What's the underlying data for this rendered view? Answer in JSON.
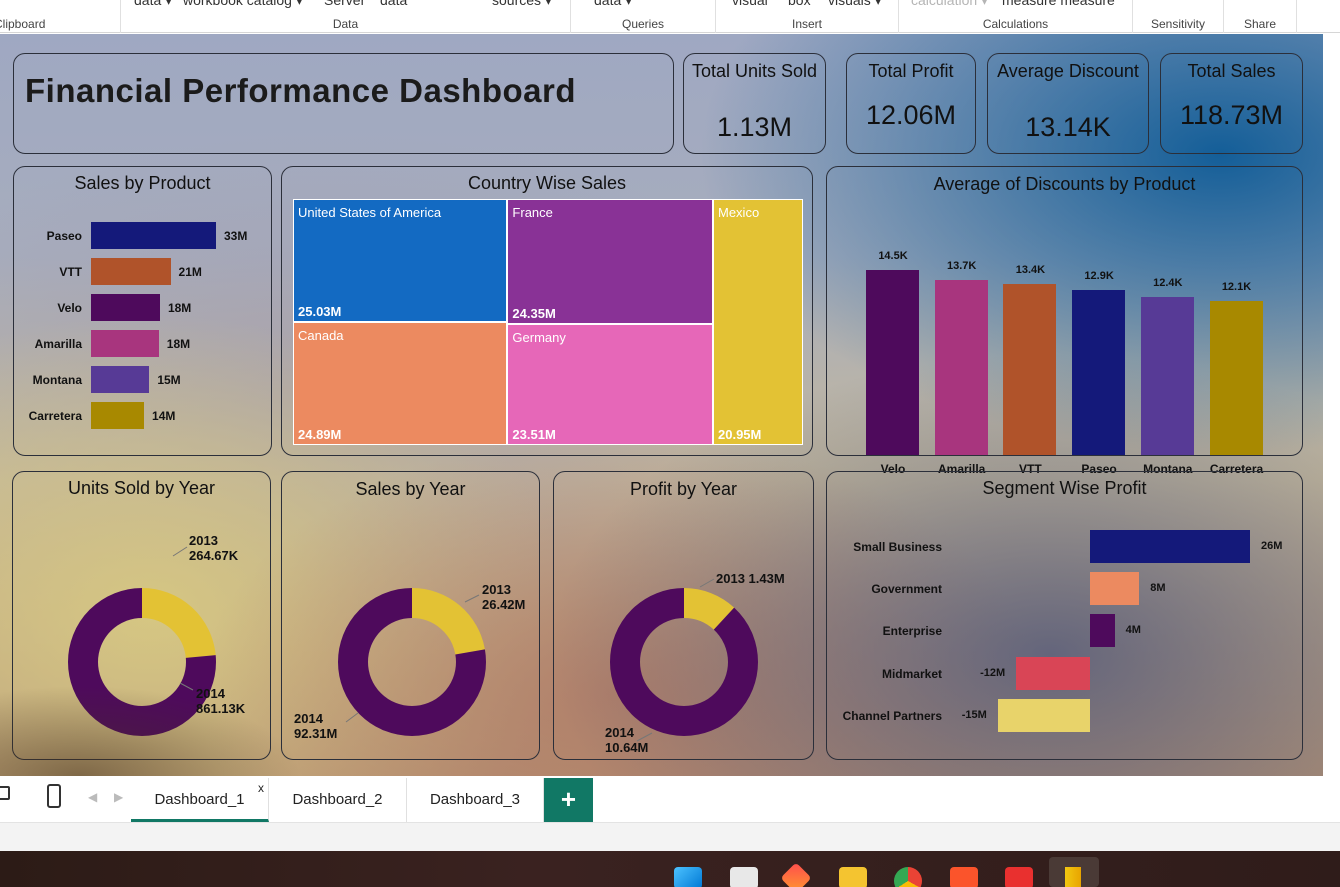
{
  "ribbon": {
    "groups": [
      {
        "label": "Clipboard"
      },
      {
        "label": "Data",
        "items": [
          "data ▾",
          "workbook catalog ▾",
          "Server",
          "data",
          "sources ▾"
        ]
      },
      {
        "label": "Queries",
        "items": [
          "data ▾"
        ]
      },
      {
        "label": "Insert",
        "items": [
          "visual",
          "box",
          "visuals ▾"
        ]
      },
      {
        "label": "Calculations",
        "items": [
          "calculation ▾",
          "measure measure"
        ]
      },
      {
        "label": "Sensitivity"
      },
      {
        "label": "Share"
      }
    ]
  },
  "dashboard": {
    "title": "Financial Performance Dashboard",
    "kpis": [
      {
        "title": "Total Units Sold",
        "value": "1.13M"
      },
      {
        "title": "Total Profit",
        "value": "12.06M"
      },
      {
        "title": "Average Discount",
        "value": "13.14K"
      },
      {
        "title": "Total Sales",
        "value": "118.73M"
      }
    ],
    "sales_by_product": {
      "title": "Sales by Product",
      "items": [
        {
          "label": "Paseo",
          "value": "33M",
          "num": 33,
          "color": "#14197a"
        },
        {
          "label": "VTT",
          "value": "21M",
          "num": 21,
          "color": "#b0532a"
        },
        {
          "label": "Velo",
          "value": "18M",
          "num": 18.2,
          "color": "#4e0a5c"
        },
        {
          "label": "Amarilla",
          "value": "18M",
          "num": 17.9,
          "color": "#a8357e"
        },
        {
          "label": "Montana",
          "value": "15M",
          "num": 15.4,
          "color": "#573a96"
        },
        {
          "label": "Carretera",
          "value": "14M",
          "num": 14,
          "color": "#a88900"
        }
      ]
    },
    "country_sales": {
      "title": "Country Wise Sales",
      "cells": [
        {
          "name": "United States of America",
          "value": "25.03M",
          "color": "#136ac2"
        },
        {
          "name": "France",
          "value": "24.35M",
          "color": "#893296"
        },
        {
          "name": "Mexico",
          "value": "20.95M",
          "color": "#e3c234"
        },
        {
          "name": "Canada",
          "value": "24.89M",
          "color": "#ec8a60"
        },
        {
          "name": "Germany",
          "value": "23.51M",
          "color": "#e667b8"
        }
      ]
    },
    "avg_discount": {
      "title": "Average of Discounts by Product",
      "items": [
        {
          "label": "Velo",
          "value": "14.5K",
          "num": 14.5,
          "color": "#4e0a5c"
        },
        {
          "label": "Amarilla",
          "value": "13.7K",
          "num": 13.7,
          "color": "#a8357e"
        },
        {
          "label": "VTT",
          "value": "13.4K",
          "num": 13.4,
          "color": "#b0532a"
        },
        {
          "label": "Paseo",
          "value": "12.9K",
          "num": 12.9,
          "color": "#14197a"
        },
        {
          "label": "Montana",
          "value": "12.4K",
          "num": 12.4,
          "color": "#573a96"
        },
        {
          "label": "Carretera",
          "value": "12.1K",
          "num": 12.1,
          "color": "#a88900"
        }
      ]
    },
    "units_by_year": {
      "title": "Units Sold by Year",
      "slices": [
        {
          "year": "2013",
          "value": "264.67K",
          "num": 264.67,
          "color": "#e3c234"
        },
        {
          "year": "2014",
          "value": "861.13K",
          "num": 861.13,
          "color": "#4e0a5c"
        }
      ]
    },
    "sales_by_year": {
      "title": "Sales by Year",
      "slices": [
        {
          "year": "2013",
          "value": "26.42M",
          "num": 26.42,
          "color": "#e3c234"
        },
        {
          "year": "2014",
          "value": "92.31M",
          "num": 92.31,
          "color": "#4e0a5c"
        }
      ]
    },
    "profit_by_year": {
      "title": "Profit by Year",
      "slices": [
        {
          "year": "2013",
          "value": "1.43M",
          "num": 1.43,
          "color": "#e3c234"
        },
        {
          "year": "2014",
          "value": "10.64M",
          "num": 10.64,
          "color": "#4e0a5c"
        }
      ]
    },
    "segment_profit": {
      "title": "Segment Wise Profit",
      "items": [
        {
          "label": "Small Business",
          "value": "26M",
          "num": 26,
          "color": "#14197a"
        },
        {
          "label": "Government",
          "value": "8M",
          "num": 8,
          "color": "#ec8a60"
        },
        {
          "label": "Enterprise",
          "value": "4M",
          "num": 4,
          "color": "#4e0a5c"
        },
        {
          "label": "Midmarket",
          "value": "-12M",
          "num": -12,
          "color": "#d94556"
        },
        {
          "label": "Channel Partners",
          "value": "-15M",
          "num": -15,
          "color": "#e8d36a"
        }
      ]
    }
  },
  "tabs": {
    "pages": [
      {
        "label": "Dashboard_1",
        "active": true
      },
      {
        "label": "Dashboard_2"
      },
      {
        "label": "Dashboard_3"
      }
    ],
    "close_glyph": "x",
    "add_glyph": "+"
  },
  "chart_data": [
    {
      "type": "bar",
      "title": "Sales by Product",
      "categories": [
        "Paseo",
        "VTT",
        "Velo",
        "Amarilla",
        "Montana",
        "Carretera"
      ],
      "values": [
        33,
        21,
        18,
        18,
        15,
        14
      ],
      "orientation": "horizontal"
    },
    {
      "type": "heatmap",
      "title": "Country Wise Sales",
      "categories": [
        "United States of America",
        "France",
        "Canada",
        "Germany",
        "Mexico"
      ],
      "values": [
        25.03,
        24.35,
        24.89,
        23.51,
        20.95
      ]
    },
    {
      "type": "bar",
      "title": "Average of Discounts by Product",
      "categories": [
        "Velo",
        "Amarilla",
        "VTT",
        "Paseo",
        "Montana",
        "Carretera"
      ],
      "values": [
        14.5,
        13.7,
        13.4,
        12.9,
        12.4,
        12.1
      ]
    },
    {
      "type": "pie",
      "title": "Units Sold by Year",
      "categories": [
        "2013",
        "2014"
      ],
      "values": [
        264.67,
        861.13
      ]
    },
    {
      "type": "pie",
      "title": "Sales by Year",
      "categories": [
        "2013",
        "2014"
      ],
      "values": [
        26.42,
        92.31
      ]
    },
    {
      "type": "pie",
      "title": "Profit by Year",
      "categories": [
        "2013",
        "2014"
      ],
      "values": [
        1.43,
        10.64
      ]
    },
    {
      "type": "bar",
      "title": "Segment Wise Profit",
      "categories": [
        "Small Business",
        "Government",
        "Enterprise",
        "Midmarket",
        "Channel Partners"
      ],
      "values": [
        26,
        8,
        4,
        -12,
        -15
      ],
      "orientation": "horizontal"
    }
  ]
}
